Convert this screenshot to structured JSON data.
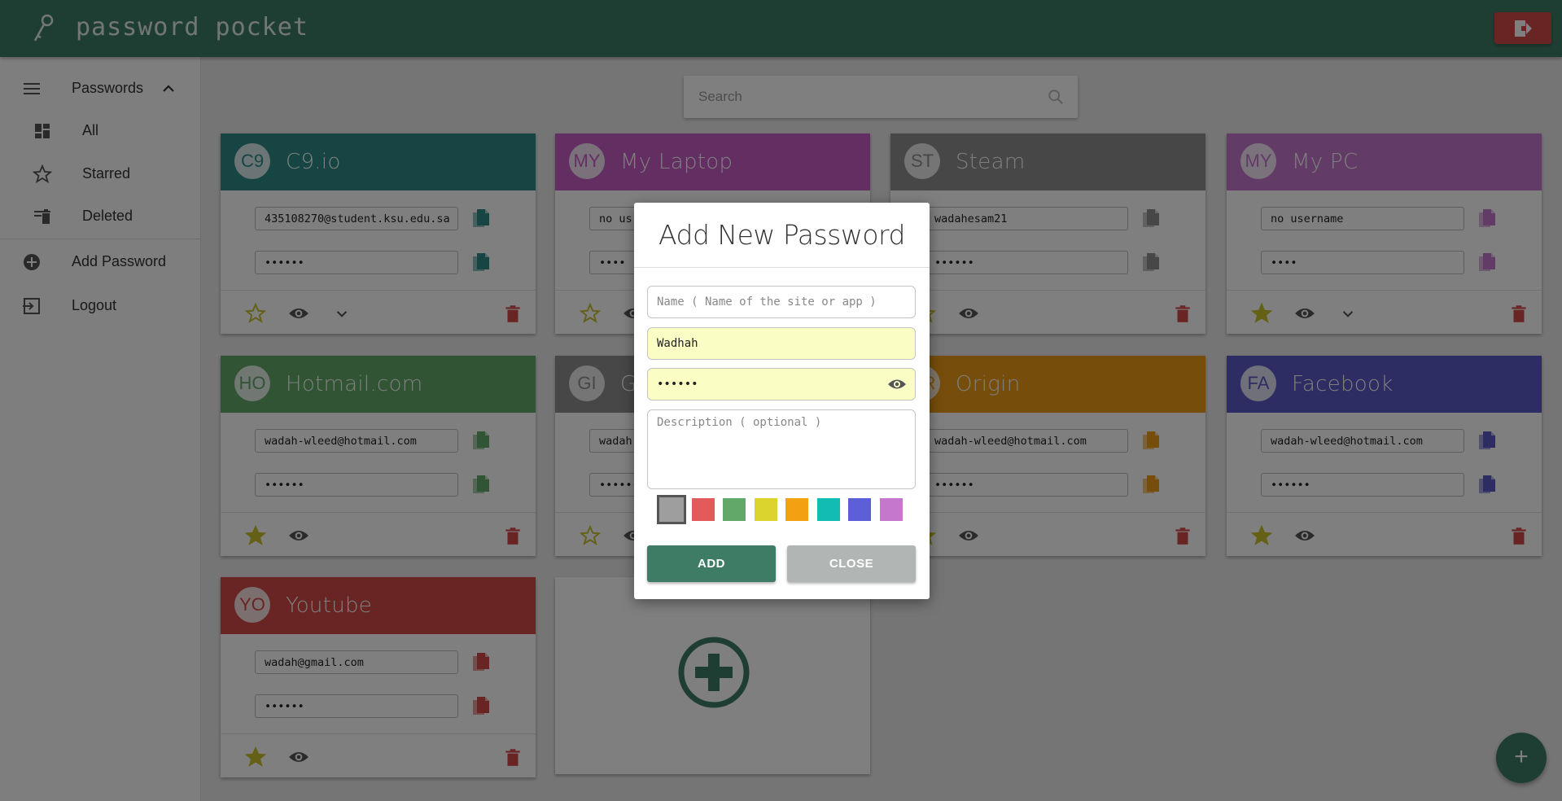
{
  "header": {
    "app_title": "password pocket",
    "logo_icon": "key-icon",
    "exit_icon": "exit-icon"
  },
  "sidebar": {
    "menu_icon": "hamburger-icon",
    "section_label": "Passwords",
    "items": [
      {
        "label": "All",
        "icon": "dashboard-icon"
      },
      {
        "label": "Starred",
        "icon": "star-outline-icon"
      },
      {
        "label": "Deleted",
        "icon": "trash-list-icon"
      }
    ],
    "add_label": "Add Password",
    "logout_label": "Logout"
  },
  "search": {
    "placeholder": "Search"
  },
  "cards": [
    {
      "initials": "C9",
      "title": "C9.io",
      "username": "435108270@student.ksu.edu.sa",
      "password": "••••••",
      "color": "#2e8b89",
      "starred": false,
      "expand": true
    },
    {
      "initials": "MY",
      "title": "My Laptop",
      "username": "no us",
      "password": "••••",
      "color": "#c65fc6",
      "starred": false,
      "expand": false
    },
    {
      "initials": "ST",
      "title": "Steam",
      "username": "wadahesam21",
      "password": "••••••",
      "color": "#8f8f8f",
      "starred": false,
      "expand": false
    },
    {
      "initials": "MY",
      "title": "My PC",
      "username": "no username",
      "password": "••••",
      "color": "#c477cc",
      "starred": true,
      "expand": true
    },
    {
      "initials": "HO",
      "title": "Hotmail.com",
      "username": "wadah-wleed@hotmail.com",
      "password": "••••••",
      "color": "#62a868",
      "starred": true,
      "expand": false
    },
    {
      "initials": "GI",
      "title": "G",
      "username": "wadah",
      "password": "••••••",
      "color": "#8f8f8f",
      "starred": false,
      "expand": false
    },
    {
      "initials": "OR",
      "title": "Origin",
      "username": "wadah-wleed@hotmail.com",
      "password": "••••••",
      "color": "#ec9a16",
      "starred": true,
      "expand": false
    },
    {
      "initials": "FA",
      "title": "Facebook",
      "username": "wadah-wleed@hotmail.com",
      "password": "••••••",
      "color": "#5a5bc7",
      "starred": true,
      "expand": false
    },
    {
      "initials": "YO",
      "title": "Youtube",
      "username": "wadah@gmail.com",
      "password": "••••••",
      "color": "#d24a48",
      "starred": true,
      "expand": false
    }
  ],
  "fab_label": "+",
  "modal": {
    "title": "Add New Password",
    "name_placeholder": "Name ( Name of the site or app )",
    "username_value": "Wadhah",
    "password_value": "••••••",
    "description_placeholder": "Description ( optional )",
    "swatches": [
      "#9e9e9e",
      "#e35a5a",
      "#62a868",
      "#dcd42e",
      "#f3a012",
      "#13bcb2",
      "#5d5fd8",
      "#c477cc"
    ],
    "selected_swatch": "#9e9e9e",
    "add_label": "ADD",
    "close_label": "CLOSE",
    "add_color": "#3f7c66",
    "close_color": "#b1b5b4"
  }
}
